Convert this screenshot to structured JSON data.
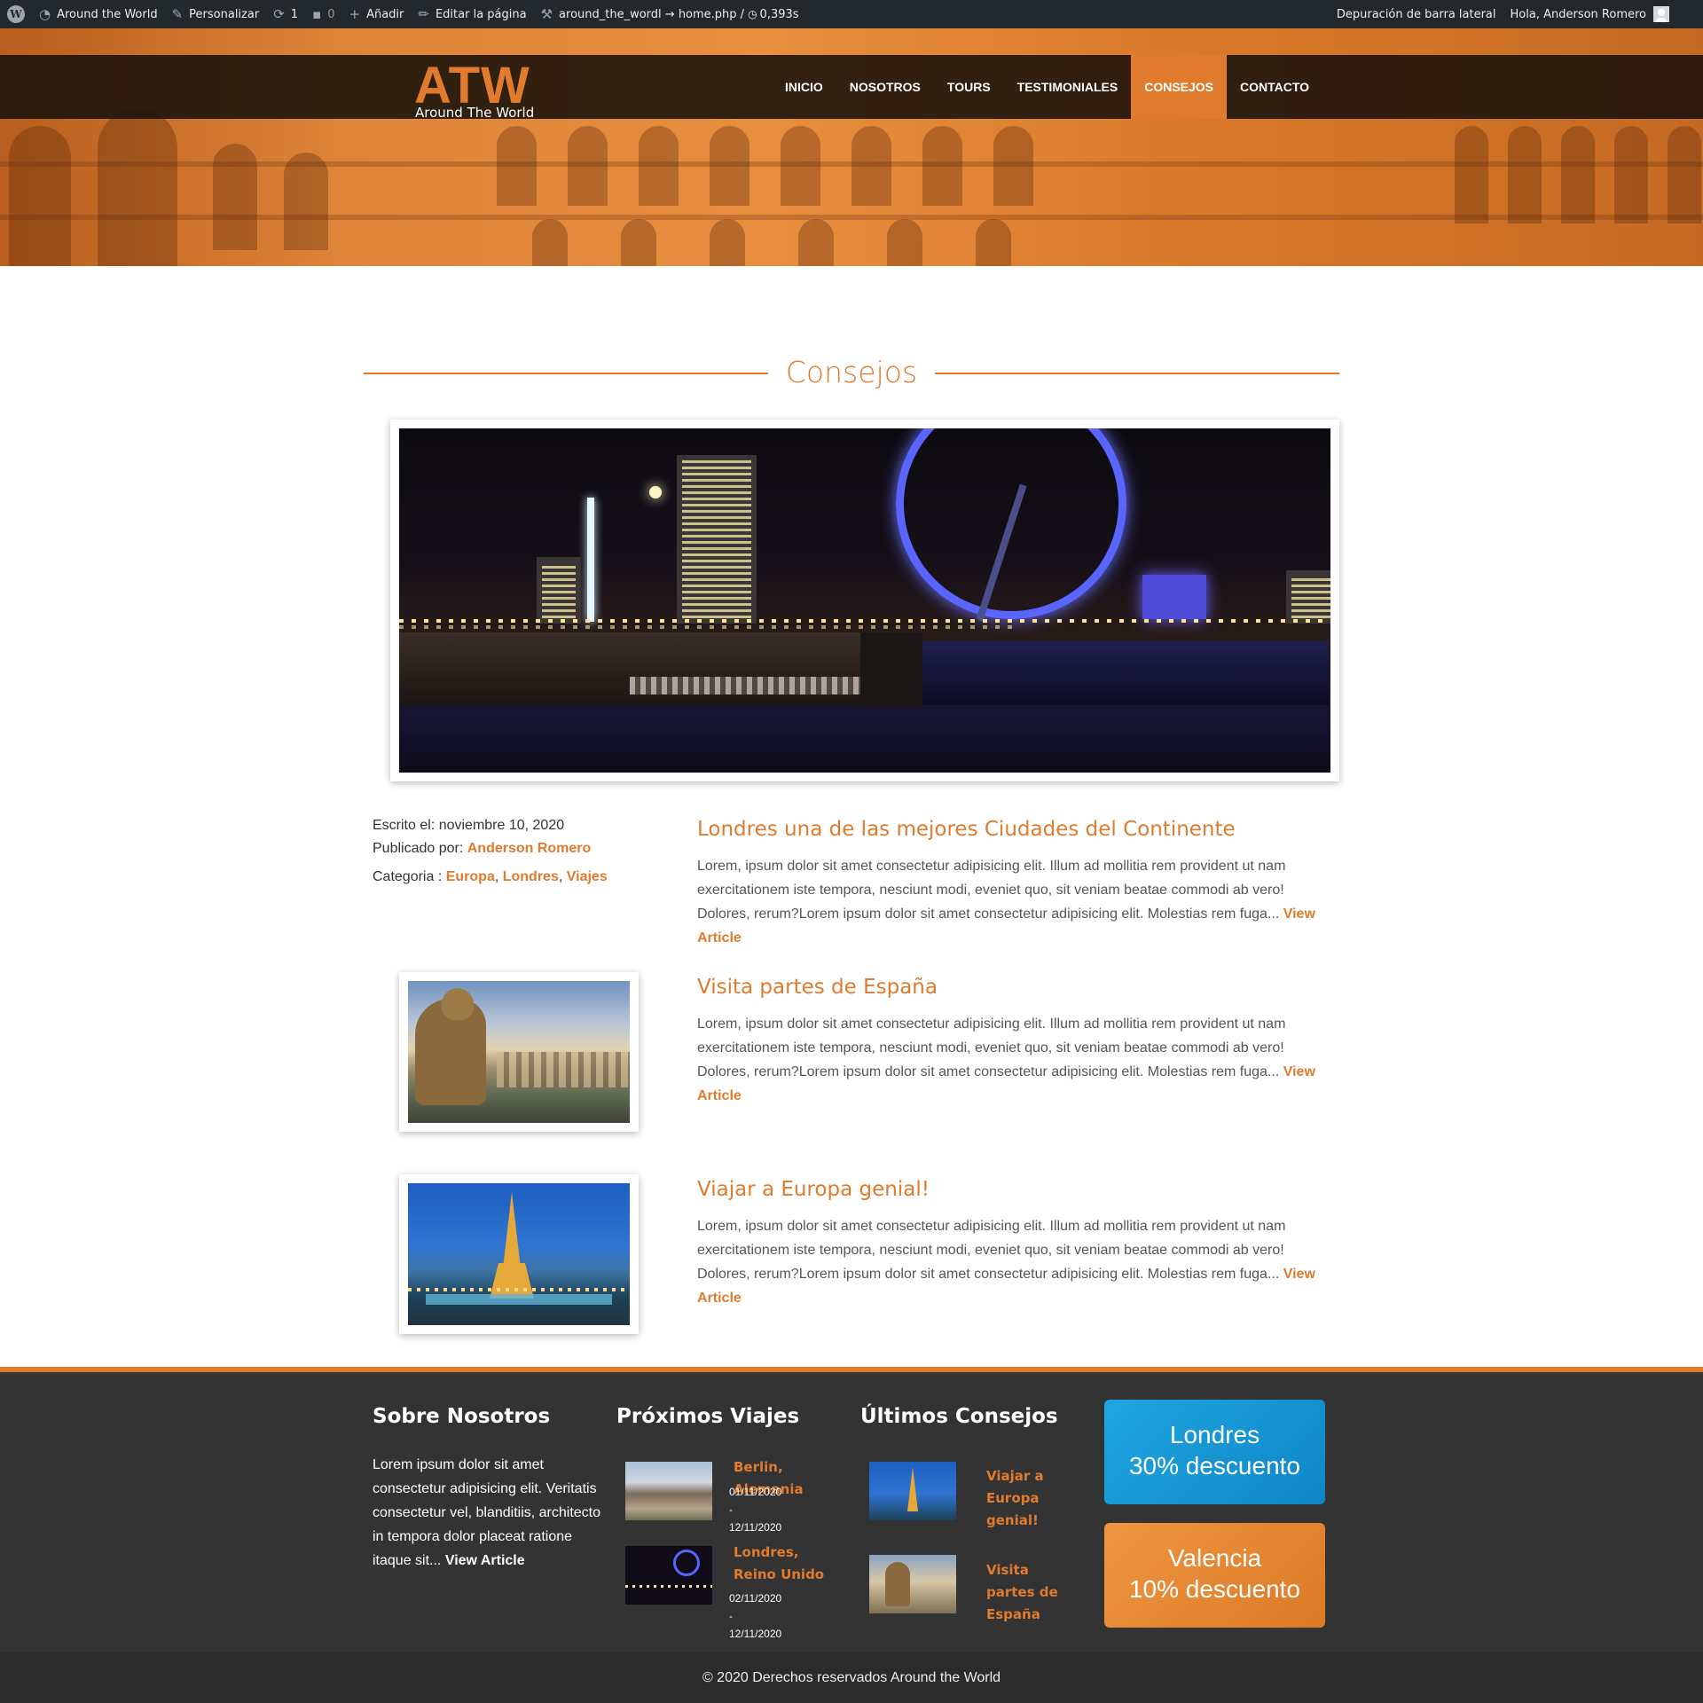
{
  "adminbar": {
    "site_name": "Around the World",
    "customize": "Personalizar",
    "updates_count": "1",
    "comments_count": "0",
    "add_new": "Añadir",
    "edit_page": "Editar la página",
    "template": "around_the_wordl → home.php / ",
    "timer": "0,393s",
    "debug_sidebar": "Depuración de barra lateral",
    "greeting": "Hola, Anderson Romero"
  },
  "header": {
    "logo_big": "ATW",
    "logo_small": "Around The World",
    "menu": [
      {
        "label": "INICIO"
      },
      {
        "label": "NOSOTROS"
      },
      {
        "label": "TOURS"
      },
      {
        "label": "TESTIMONIALES"
      },
      {
        "label": "CONSEJOS"
      },
      {
        "label": "CONTACTO"
      }
    ]
  },
  "page": {
    "title": "Consejos"
  },
  "featured": {
    "written_label": "Escrito el: ",
    "written_date": "noviembre 10, 2020",
    "published_label": "Publicado por: ",
    "author": "Anderson Romero",
    "category_label": "Categoria : ",
    "categories": [
      "Europa",
      "Londres",
      "Viajes"
    ]
  },
  "posts": [
    {
      "title": "Londres una de las mejores Ciudades del Continente",
      "excerpt": "Lorem, ipsum dolor sit amet consectetur adipisicing elit. Illum ad mollitia rem provident ut nam exercitationem iste tempora, nesciunt modi, eveniet quo, sit veniam beatae commodi ab vero! Dolores, rerum?Lorem ipsum dolor sit amet consectetur adipisicing elit. Molestias rem fuga...",
      "more": "View Article"
    },
    {
      "title": "Visita partes de España",
      "excerpt": "Lorem, ipsum dolor sit amet consectetur adipisicing elit. Illum ad mollitia rem provident ut nam exercitationem iste tempora, nesciunt modi, eveniet quo, sit veniam beatae commodi ab vero! Dolores, rerum?Lorem ipsum dolor sit amet consectetur adipisicing elit. Molestias rem fuga...",
      "more": "View Article"
    },
    {
      "title": "Viajar a Europa genial!",
      "excerpt": "Lorem, ipsum dolor sit amet consectetur adipisicing elit. Illum ad mollitia rem provident ut nam exercitationem iste tempora, nesciunt modi, eveniet quo, sit veniam beatae commodi ab vero! Dolores, rerum?Lorem ipsum dolor sit amet consectetur adipisicing elit. Molestias rem fuga...",
      "more": "View Article"
    }
  ],
  "footer": {
    "about": {
      "heading": "Sobre Nosotros",
      "text": "Lorem ipsum dolor sit amet consectetur adipisicing elit. Veritatis consectetur vel, blanditiis, architecto in tempora dolor placeat ratione itaque sit...",
      "more": "View Article"
    },
    "trips": {
      "heading": "Próximos Viajes",
      "items": [
        {
          "name": "Berlin, Alemania",
          "start": "01/11/2020",
          "sep": "-",
          "end": "12/11/2020"
        },
        {
          "name": "Londres, Reino Unido",
          "start": "02/11/2020",
          "sep": "-",
          "end": "12/11/2020"
        }
      ]
    },
    "tips": {
      "heading": "Últimos Consejos",
      "items": [
        {
          "title": "Viajar a Europa genial!"
        },
        {
          "title": "Visita partes de España"
        }
      ]
    },
    "promos": [
      {
        "city": "Londres",
        "discount": "30% descuento"
      },
      {
        "city": "Valencia",
        "discount": "10% descuento"
      }
    ],
    "copyright": "© 2020 Derechos reservados Around the World"
  },
  "colors": {
    "accent": "#e07b2e",
    "adminbar": "#23282d",
    "footer": "#333333",
    "promo_blue": "#1a9ad6",
    "promo_orange": "#e8882e"
  }
}
